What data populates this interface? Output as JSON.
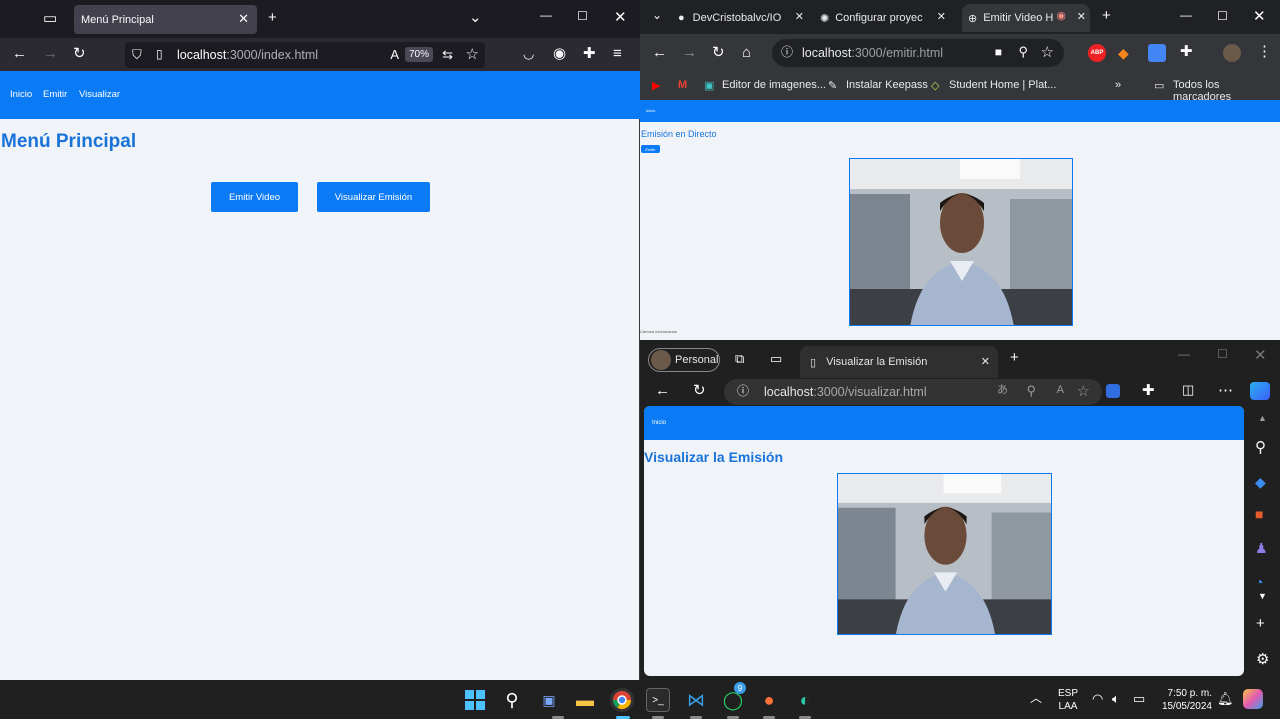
{
  "firefox": {
    "tab_title": "Menú Principal",
    "url_host": "localhost",
    "url_path": ":3000/index.html",
    "zoom": "70%",
    "nav": [
      "Inicio",
      "Emitir",
      "Visualizar"
    ],
    "heading": "Menú Principal",
    "buttons": [
      "Emitir Video",
      "Visualizar Emisión"
    ]
  },
  "chrome": {
    "tabs": [
      "DevCristobalvc/IO",
      "Configurar proyec",
      "Emitir Video H"
    ],
    "url_host": "localhost",
    "url_path": ":3000/emitir.html",
    "extension_badge": "ABP",
    "bookmarks": [
      "Editor de imagenes...",
      "Instalar Keepass",
      "Student Home | Plat...",
      "Todos los marcadores"
    ],
    "nav_link": "Inicio",
    "heading": "Emisión en Directo",
    "small_button": "Emitir",
    "status": "Cámara funcionando"
  },
  "edge": {
    "profile": "Personal",
    "tab_title": "Visualizar la Emisión",
    "url_host": "localhost",
    "url_path": ":3000/visualizar.html",
    "nav_link": "Inicio",
    "heading": "Visualizar la Emisión"
  },
  "taskbar": {
    "language": "ESP",
    "layout": "LAA",
    "time": "7:50 p. m.",
    "date": "15/05/2024",
    "whatsapp_badge": "9"
  },
  "colors": {
    "accent_blue": "#0a7af5",
    "heading_blue": "#1a73d9",
    "page_bg": "#f0f4f8"
  }
}
